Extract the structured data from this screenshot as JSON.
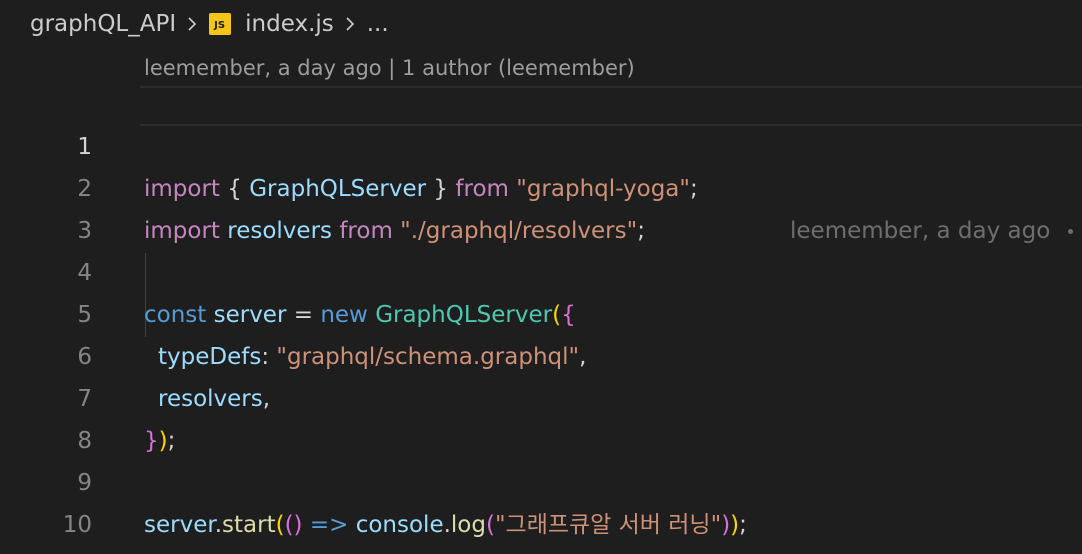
{
  "breadcrumb": {
    "folder": "graphQL_API",
    "file_icon": "JS",
    "file": "index.js",
    "more": "..."
  },
  "blame": {
    "header": "leemember, a day ago | 1 author (leemember)",
    "inline": "leemember, a day ago"
  },
  "editor": {
    "active_line": 1,
    "lines": [
      {
        "number": "1"
      },
      {
        "number": "2"
      },
      {
        "number": "3"
      },
      {
        "number": "4"
      },
      {
        "number": "5"
      },
      {
        "number": "6"
      },
      {
        "number": "7"
      },
      {
        "number": "8"
      },
      {
        "number": "9"
      },
      {
        "number": "10"
      }
    ],
    "tokens": {
      "l1": [
        "import",
        " { ",
        "GraphQLServer",
        " } ",
        "from",
        " ",
        "\"graphql-yoga\"",
        ";"
      ],
      "l2": [
        "import",
        " ",
        "resolvers",
        " ",
        "from",
        " ",
        "\"./graphql/resolvers\"",
        ";"
      ],
      "l4": [
        "const",
        " ",
        "server",
        " = ",
        "new",
        " ",
        "GraphQLServer",
        "(",
        "{"
      ],
      "l5": [
        "typeDefs",
        ": ",
        "\"graphql/schema.graphql\"",
        ","
      ],
      "l6": [
        "resolvers",
        ","
      ],
      "l7": [
        "}",
        ")",
        ";"
      ],
      "l9": [
        "server",
        ".",
        "start",
        "(",
        "()",
        " => ",
        "console",
        ".",
        "log",
        "(",
        "\"그래프큐알 서버 러닝\"",
        ")",
        ")",
        ";"
      ]
    }
  },
  "colors": {
    "background": "#1e1e1e",
    "keyword": "#c586c0",
    "storage": "#569cd6",
    "variable": "#9cdcfe",
    "class": "#4ec9b0",
    "string": "#ce9178",
    "function": "#dcdcaa",
    "bracket": "#ffd700",
    "js_icon": "#f5c518"
  }
}
